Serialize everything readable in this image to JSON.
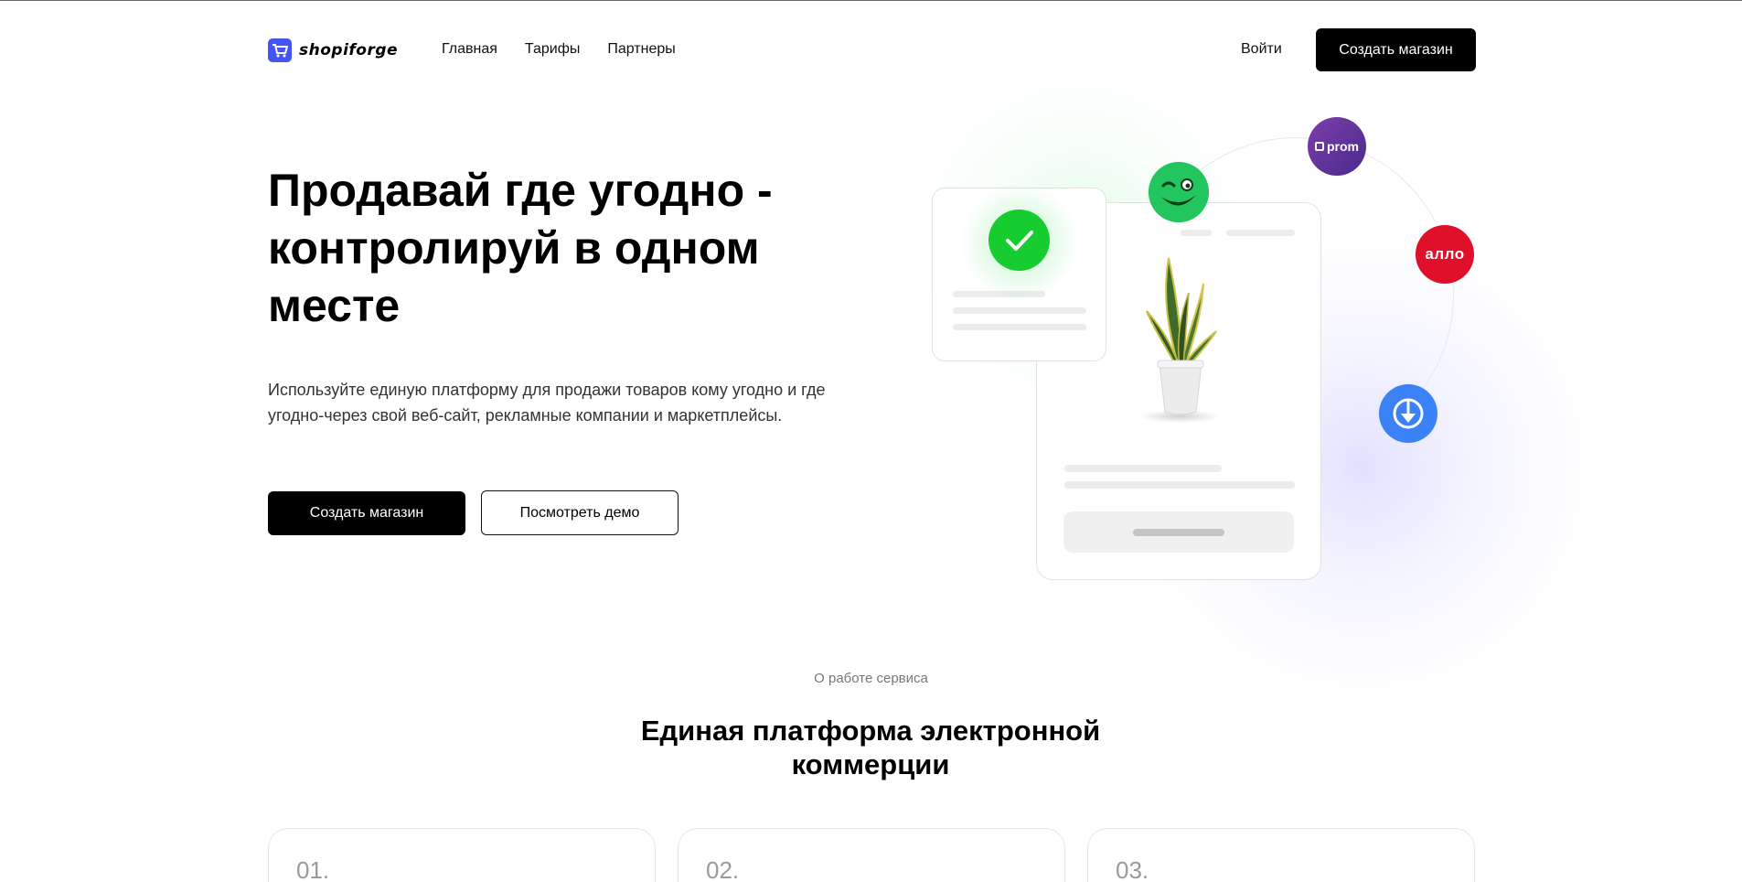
{
  "header": {
    "logo_text": "shopiforge",
    "nav": [
      "Главная",
      "Тарифы",
      "Партнеры"
    ],
    "login_label": "Войти",
    "cta_label": "Создать магазин"
  },
  "hero": {
    "title": "Продавай где угодно - контролируй в одном месте",
    "subtitle": "Используйте единую платформу для продажи товаров кому угодно и где угодно-через свой веб-сайт, рекламные компании и маркетплейсы.",
    "primary_button": "Создать магазин",
    "secondary_button": "Посмотреть демо"
  },
  "illustration": {
    "marketplaces": [
      {
        "name": "rozetka",
        "label": ""
      },
      {
        "name": "prom",
        "label": "prom"
      },
      {
        "name": "allo",
        "label": "алло"
      },
      {
        "name": "epicentr",
        "label": ""
      }
    ]
  },
  "about": {
    "kicker": "О работе сервиса",
    "title": "Единая платформа электронной коммерции",
    "steps": [
      {
        "number": "01."
      },
      {
        "number": "02."
      },
      {
        "number": "03."
      }
    ]
  },
  "colors": {
    "brand_blue": "#4356f5",
    "success_green": "#16cc2e",
    "prom_purple": "#6a35a0",
    "allo_red": "#e0102b",
    "epicentr_blue": "#3b82f6"
  }
}
